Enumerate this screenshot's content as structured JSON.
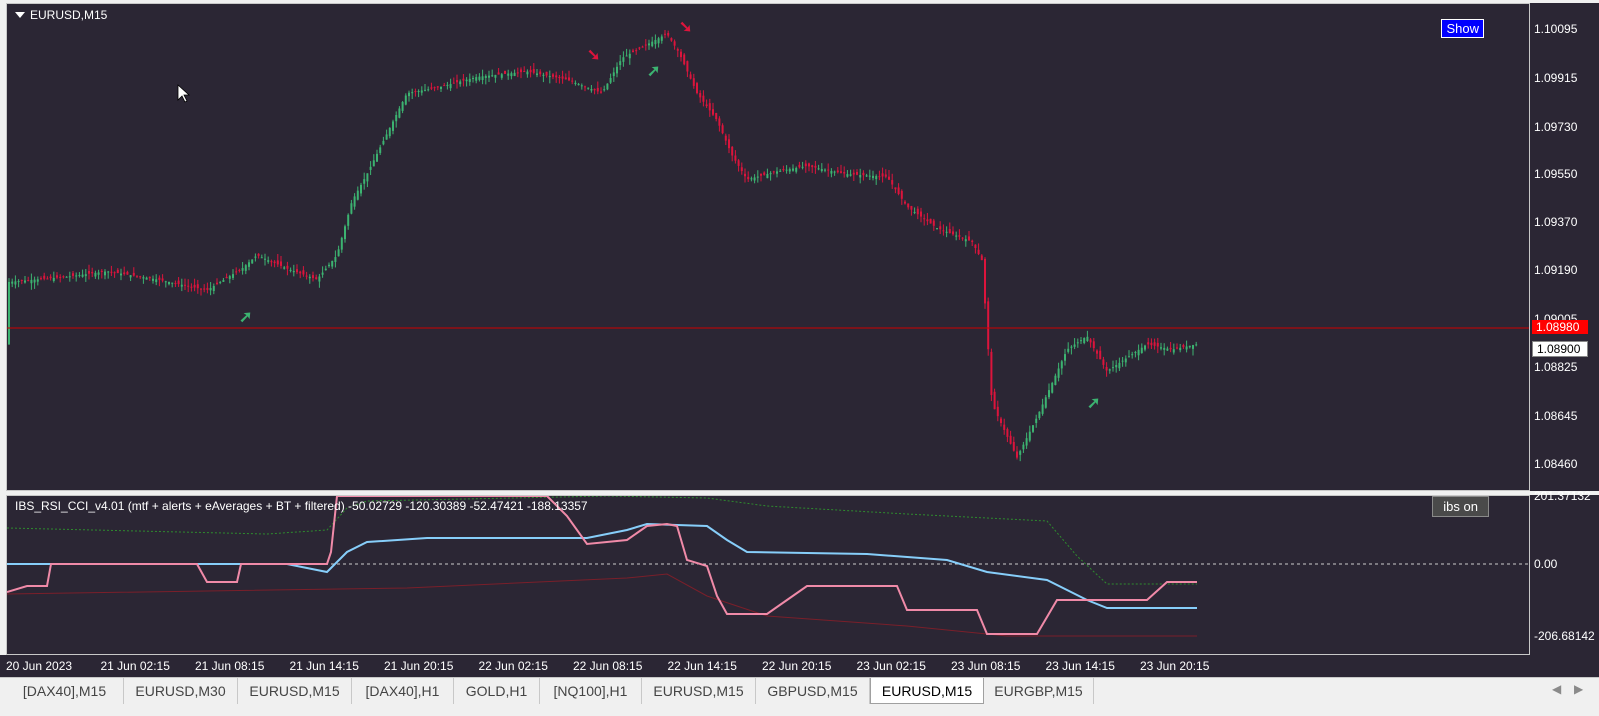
{
  "chart": {
    "title": "EURUSD,M15",
    "show_button_label": "Show",
    "price_ticks": [
      "1.10095",
      "1.09915",
      "1.09730",
      "1.09550",
      "1.09370",
      "1.09190",
      "1.09005",
      "1.08825",
      "1.08645",
      "1.08460"
    ],
    "price_range": [
      1.0838,
      1.1018
    ],
    "bid_line_value": 1.0898,
    "bid_tag_label": "1.08980",
    "ask_tag_label": "1.08900",
    "colors": {
      "background": "#2b2634",
      "bull": "#3cb371",
      "bear": "#dc143c",
      "bid_line": "#cc0000"
    }
  },
  "indicator": {
    "title": "IBS_RSI_CCI_v4.01 (mtf + alerts + eAverages + BT + filtered) -50.02729 -120.30389 -52.47421 -188.13357",
    "button_label": "ibs on",
    "axis_ticks": [
      "201.37132",
      "0.00",
      "-206.68142"
    ],
    "range": [
      -206.68142,
      201.37132
    ]
  },
  "time_axis": [
    "20 Jun 2023",
    "21 Jun 02:15",
    "21 Jun 08:15",
    "21 Jun 14:15",
    "21 Jun 20:15",
    "22 Jun 02:15",
    "22 Jun 08:15",
    "22 Jun 14:15",
    "22 Jun 20:15",
    "23 Jun 02:15",
    "23 Jun 08:15",
    "23 Jun 14:15",
    "23 Jun 20:15"
  ],
  "tabs": [
    {
      "label": "[DAX40],M15",
      "active": false
    },
    {
      "label": "EURUSD,M30",
      "active": false
    },
    {
      "label": "EURUSD,M15",
      "active": false
    },
    {
      "label": "[DAX40],H1",
      "active": false
    },
    {
      "label": "GOLD,H1",
      "active": false
    },
    {
      "label": "[NQ100],H1",
      "active": false
    },
    {
      "label": "EURUSD,M15",
      "active": false
    },
    {
      "label": "GBPUSD,M15",
      "active": false
    },
    {
      "label": "EURUSD,M15",
      "active": true
    },
    {
      "label": "EURGBP,M15",
      "active": false
    }
  ],
  "icons": {
    "collapse": "triangle-down-icon",
    "scroll_left": "arrow-left-icon",
    "scroll_right": "arrow-right-icon",
    "cursor": "mouse-pointer-icon"
  }
}
